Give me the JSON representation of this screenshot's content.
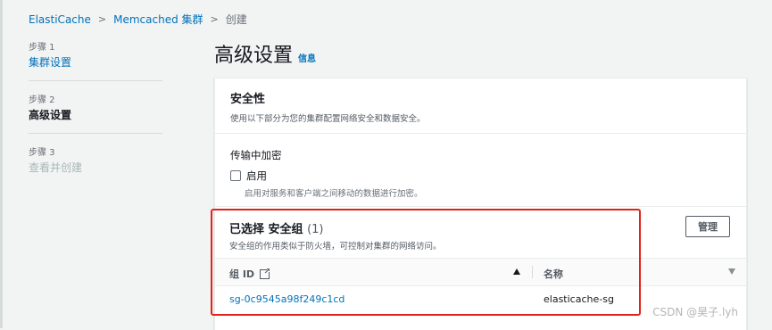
{
  "breadcrumb": {
    "items": [
      "ElastiCache",
      "Memcached 集群",
      "创建"
    ]
  },
  "steps": [
    {
      "num": "步骤 1",
      "label": "集群设置",
      "state": "link"
    },
    {
      "num": "步骤 2",
      "label": "高级设置",
      "state": "current"
    },
    {
      "num": "步骤 3",
      "label": "查看并创建",
      "state": "disabled"
    }
  ],
  "page": {
    "title": "高级设置",
    "info": "信息"
  },
  "security": {
    "title": "安全性",
    "description": "使用以下部分为您的集群配置网络安全和数据安全。",
    "encryption_label": "传输中加密",
    "enable_label": "启用",
    "enable_description": "启用对服务和客户端之间移动的数据进行加密。"
  },
  "security_groups": {
    "title": "已选择 安全组",
    "count": "(1)",
    "description": "安全组的作用类似于防火墙，可控制对集群的网络访问。",
    "manage_label": "管理",
    "columns": [
      "组 ID",
      "名称"
    ],
    "rows": [
      {
        "id": "sg-0c9545a98f249c1cd",
        "name": "elasticache-sg"
      }
    ]
  },
  "watermark": "CSDN @昊子.lyh",
  "colors": {
    "link": "#0073bb",
    "highlight": "#e2231a"
  }
}
